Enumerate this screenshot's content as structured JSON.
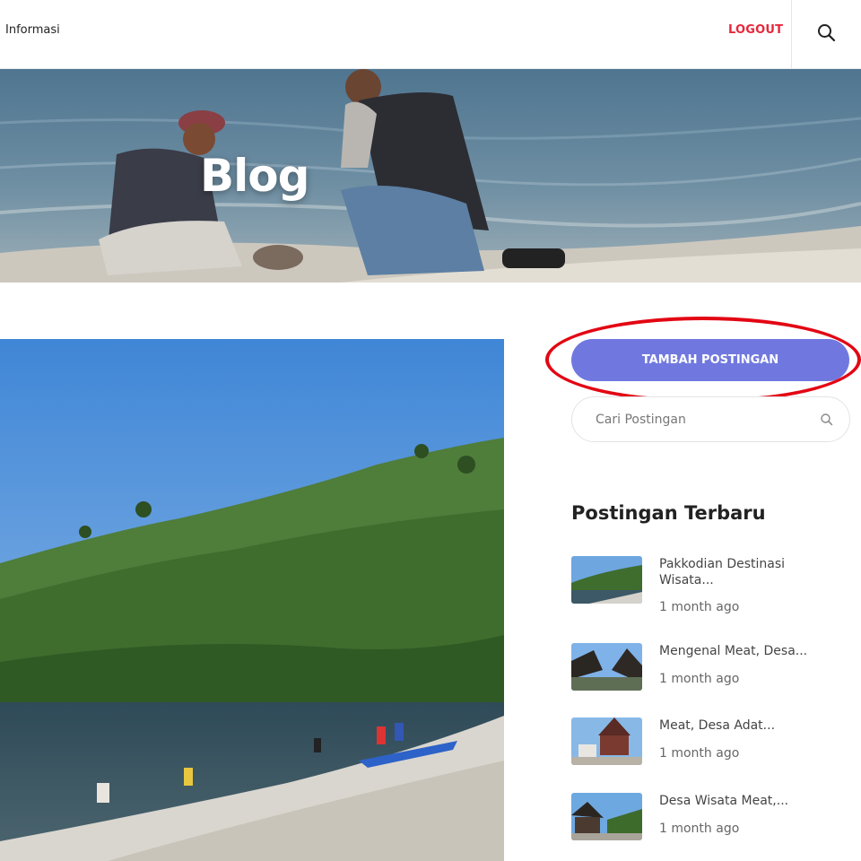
{
  "header": {
    "nav_item": "Informasi",
    "logout_label": "LOGOUT",
    "search_icon": "search-icon"
  },
  "hero": {
    "title": "Blog"
  },
  "sidebar": {
    "add_post_label": "TAMBAH POSTINGAN",
    "search_placeholder": "Cari Postingan",
    "recent_title": "Postingan Terbaru",
    "recent_posts": [
      {
        "title_line1": "Pakkodian Destinasi",
        "title_line2": "Wisata...",
        "time": "1 month ago"
      },
      {
        "title_line1": "Mengenal Meat, Desa...",
        "time": "1 month ago"
      },
      {
        "title_line1": "Meat, Desa Adat...",
        "time": "1 month ago"
      },
      {
        "title_line1": "Desa Wisata Meat,...",
        "time": "1 month ago"
      }
    ]
  },
  "colors": {
    "accent_button": "#7078df",
    "logout_red": "#e8283c",
    "highlight_ring": "#e30613"
  }
}
